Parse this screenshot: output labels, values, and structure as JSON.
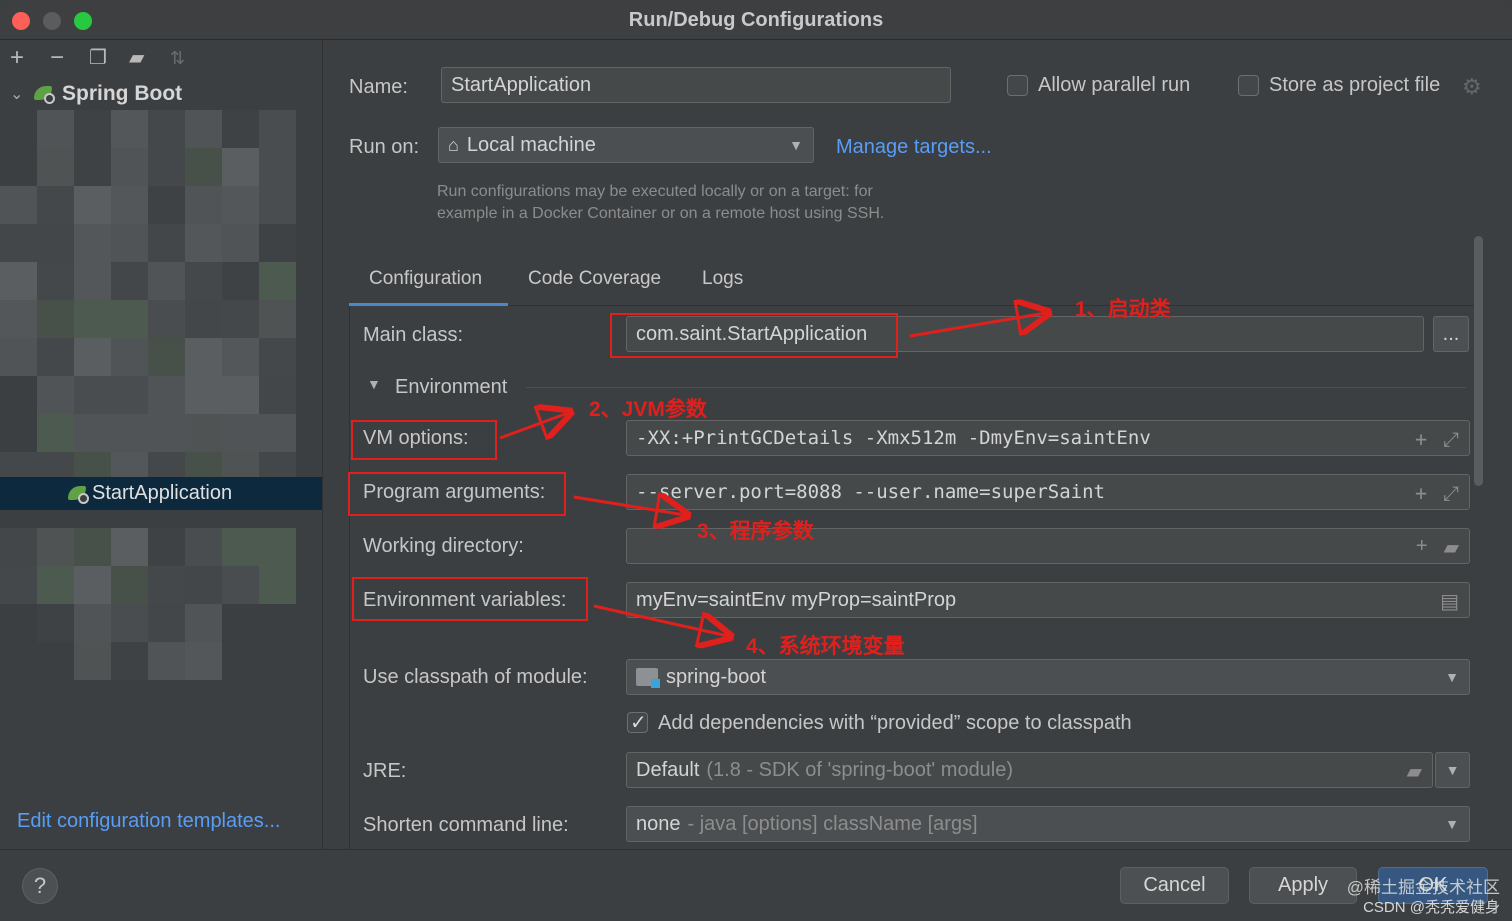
{
  "window": {
    "title": "Run/Debug Configurations"
  },
  "left_panel": {
    "tree_group": "Spring Boot",
    "selected_item": "StartApplication",
    "edit_templates_link": "Edit configuration templates..."
  },
  "header": {
    "name_label": "Name:",
    "name_value": "StartApplication",
    "allow_parallel_label": "Allow parallel run",
    "store_project_label": "Store as project file",
    "run_on_label": "Run on:",
    "run_on_value": "Local machine",
    "manage_targets": "Manage targets...",
    "hint_line1": "Run configurations may be executed locally or on a target: for",
    "hint_line2": "example in a Docker Container or on a remote host using SSH."
  },
  "tabs": [
    {
      "label": "Configuration",
      "active": true
    },
    {
      "label": "Code Coverage",
      "active": false
    },
    {
      "label": "Logs",
      "active": false
    }
  ],
  "config": {
    "main_class_label": "Main class:",
    "main_class_value": "com.saint.StartApplication",
    "browse_button": "...",
    "environment_label": "Environment",
    "vm_options_label": "VM options:",
    "vm_options_value": "-XX:+PrintGCDetails -Xmx512m -DmyEnv=saintEnv",
    "program_args_label": "Program arguments:",
    "program_args_value": "--server.port=8088 --user.name=superSaint",
    "working_dir_label": "Working directory:",
    "working_dir_value": "",
    "env_vars_label": "Environment variables:",
    "env_vars_value": "myEnv=saintEnv myProp=saintProp",
    "classpath_label": "Use classpath of module:",
    "classpath_value": "spring-boot",
    "add_deps_label": "Add dependencies with “provided” scope to classpath",
    "jre_label": "JRE:",
    "jre_value": "Default",
    "jre_detail": "(1.8 - SDK of 'spring-boot' module)",
    "shorten_label": "Shorten command line:",
    "shorten_value": "none",
    "shorten_detail": "- java [options] className [args]"
  },
  "buttons": {
    "help": "?",
    "cancel": "Cancel",
    "apply": "Apply",
    "ok": "OK"
  },
  "annotations": {
    "a1": "1、启动类",
    "a2": "2、JVM参数",
    "a3": "3、程序参数",
    "a4": "4、系统环境变量"
  },
  "watermark": {
    "line1": "@稀土掘金技术社区",
    "line2": "CSDN @秃秃爱健身"
  },
  "colors": {
    "accent": "#589df6",
    "annotation": "#e0201c",
    "selection": "#0d293e"
  }
}
